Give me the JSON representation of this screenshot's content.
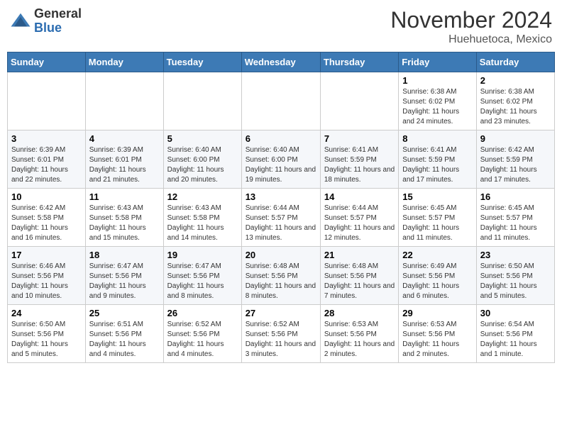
{
  "header": {
    "logo_general": "General",
    "logo_blue": "Blue",
    "month_title": "November 2024",
    "location": "Huehuetoca, Mexico"
  },
  "days_of_week": [
    "Sunday",
    "Monday",
    "Tuesday",
    "Wednesday",
    "Thursday",
    "Friday",
    "Saturday"
  ],
  "weeks": [
    [
      {
        "day": "",
        "info": ""
      },
      {
        "day": "",
        "info": ""
      },
      {
        "day": "",
        "info": ""
      },
      {
        "day": "",
        "info": ""
      },
      {
        "day": "",
        "info": ""
      },
      {
        "day": "1",
        "info": "Sunrise: 6:38 AM\nSunset: 6:02 PM\nDaylight: 11 hours and 24 minutes."
      },
      {
        "day": "2",
        "info": "Sunrise: 6:38 AM\nSunset: 6:02 PM\nDaylight: 11 hours and 23 minutes."
      }
    ],
    [
      {
        "day": "3",
        "info": "Sunrise: 6:39 AM\nSunset: 6:01 PM\nDaylight: 11 hours and 22 minutes."
      },
      {
        "day": "4",
        "info": "Sunrise: 6:39 AM\nSunset: 6:01 PM\nDaylight: 11 hours and 21 minutes."
      },
      {
        "day": "5",
        "info": "Sunrise: 6:40 AM\nSunset: 6:00 PM\nDaylight: 11 hours and 20 minutes."
      },
      {
        "day": "6",
        "info": "Sunrise: 6:40 AM\nSunset: 6:00 PM\nDaylight: 11 hours and 19 minutes."
      },
      {
        "day": "7",
        "info": "Sunrise: 6:41 AM\nSunset: 5:59 PM\nDaylight: 11 hours and 18 minutes."
      },
      {
        "day": "8",
        "info": "Sunrise: 6:41 AM\nSunset: 5:59 PM\nDaylight: 11 hours and 17 minutes."
      },
      {
        "day": "9",
        "info": "Sunrise: 6:42 AM\nSunset: 5:59 PM\nDaylight: 11 hours and 17 minutes."
      }
    ],
    [
      {
        "day": "10",
        "info": "Sunrise: 6:42 AM\nSunset: 5:58 PM\nDaylight: 11 hours and 16 minutes."
      },
      {
        "day": "11",
        "info": "Sunrise: 6:43 AM\nSunset: 5:58 PM\nDaylight: 11 hours and 15 minutes."
      },
      {
        "day": "12",
        "info": "Sunrise: 6:43 AM\nSunset: 5:58 PM\nDaylight: 11 hours and 14 minutes."
      },
      {
        "day": "13",
        "info": "Sunrise: 6:44 AM\nSunset: 5:57 PM\nDaylight: 11 hours and 13 minutes."
      },
      {
        "day": "14",
        "info": "Sunrise: 6:44 AM\nSunset: 5:57 PM\nDaylight: 11 hours and 12 minutes."
      },
      {
        "day": "15",
        "info": "Sunrise: 6:45 AM\nSunset: 5:57 PM\nDaylight: 11 hours and 11 minutes."
      },
      {
        "day": "16",
        "info": "Sunrise: 6:45 AM\nSunset: 5:57 PM\nDaylight: 11 hours and 11 minutes."
      }
    ],
    [
      {
        "day": "17",
        "info": "Sunrise: 6:46 AM\nSunset: 5:56 PM\nDaylight: 11 hours and 10 minutes."
      },
      {
        "day": "18",
        "info": "Sunrise: 6:47 AM\nSunset: 5:56 PM\nDaylight: 11 hours and 9 minutes."
      },
      {
        "day": "19",
        "info": "Sunrise: 6:47 AM\nSunset: 5:56 PM\nDaylight: 11 hours and 8 minutes."
      },
      {
        "day": "20",
        "info": "Sunrise: 6:48 AM\nSunset: 5:56 PM\nDaylight: 11 hours and 8 minutes."
      },
      {
        "day": "21",
        "info": "Sunrise: 6:48 AM\nSunset: 5:56 PM\nDaylight: 11 hours and 7 minutes."
      },
      {
        "day": "22",
        "info": "Sunrise: 6:49 AM\nSunset: 5:56 PM\nDaylight: 11 hours and 6 minutes."
      },
      {
        "day": "23",
        "info": "Sunrise: 6:50 AM\nSunset: 5:56 PM\nDaylight: 11 hours and 5 minutes."
      }
    ],
    [
      {
        "day": "24",
        "info": "Sunrise: 6:50 AM\nSunset: 5:56 PM\nDaylight: 11 hours and 5 minutes."
      },
      {
        "day": "25",
        "info": "Sunrise: 6:51 AM\nSunset: 5:56 PM\nDaylight: 11 hours and 4 minutes."
      },
      {
        "day": "26",
        "info": "Sunrise: 6:52 AM\nSunset: 5:56 PM\nDaylight: 11 hours and 4 minutes."
      },
      {
        "day": "27",
        "info": "Sunrise: 6:52 AM\nSunset: 5:56 PM\nDaylight: 11 hours and 3 minutes."
      },
      {
        "day": "28",
        "info": "Sunrise: 6:53 AM\nSunset: 5:56 PM\nDaylight: 11 hours and 2 minutes."
      },
      {
        "day": "29",
        "info": "Sunrise: 6:53 AM\nSunset: 5:56 PM\nDaylight: 11 hours and 2 minutes."
      },
      {
        "day": "30",
        "info": "Sunrise: 6:54 AM\nSunset: 5:56 PM\nDaylight: 11 hours and 1 minute."
      }
    ]
  ]
}
